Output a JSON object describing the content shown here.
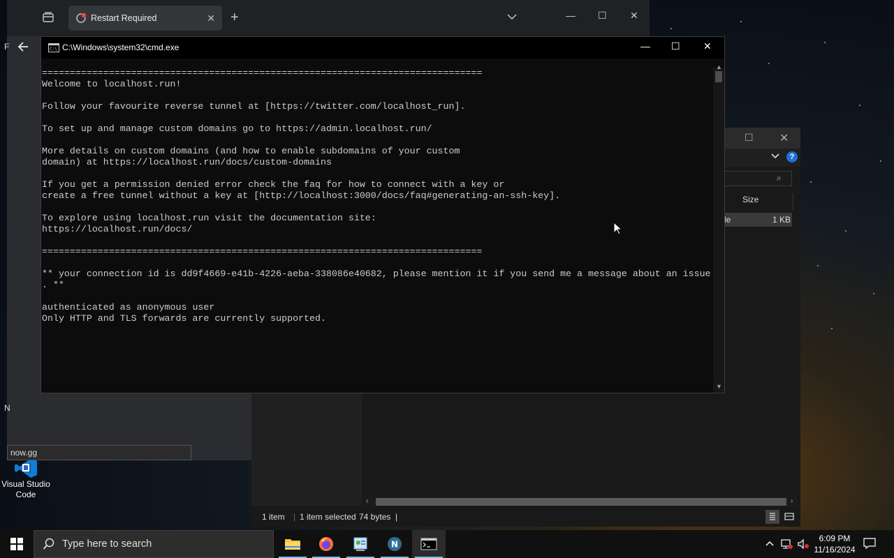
{
  "browser": {
    "tab_title": "Restart Required",
    "side_letters": [
      "F",
      "N"
    ]
  },
  "cmd": {
    "title": "C:\\Windows\\system32\\cmd.exe",
    "lines": [
      "===============================================================================",
      "Welcome to localhost.run!",
      "",
      "Follow your favourite reverse tunnel at [https://twitter.com/localhost_run].",
      "",
      "To set up and manage custom domains go to https://admin.localhost.run/",
      "",
      "More details on custom domains (and how to enable subdomains of your custom",
      "domain) at https://localhost.run/docs/custom-domains",
      "",
      "If you get a permission denied error check the faq for how to connect with a key or",
      "create a free tunnel without a key at [http://localhost:3000/docs/faq#generating-an-ssh-key].",
      "",
      "To explore using localhost.run visit the documentation site:",
      "https://localhost.run/docs/",
      "",
      "===============================================================================",
      "",
      "** your connection id is dd9f4669-e41b-4226-aeba-338086e40682, please mention it if you send me a message about an issue",
      ". **",
      "",
      "authenticated as anonymous user",
      "Only HTTP and TLS forwards are currently supported."
    ]
  },
  "explorer": {
    "column_size": "Size",
    "row_type_fragment": "le",
    "row_size": "1 KB",
    "status_items": "1 item",
    "status_selected": "1 item selected",
    "status_size": "74 bytes",
    "status_sep": "|"
  },
  "tooltip": {
    "text": "now.gg"
  },
  "desktop_icon": {
    "label_line1": "Visual Studio",
    "label_line2": "Code"
  },
  "taskbar": {
    "search_placeholder": "Type here to search",
    "time": "6:09 PM",
    "date": "11/16/2024",
    "apps": [
      "file-explorer",
      "firefox",
      "control-panel",
      "network-app",
      "command-prompt"
    ]
  },
  "colors": {
    "accent": "#76b9ed",
    "help_blue": "#1e6fd9",
    "restart_badge": "#d13438"
  }
}
